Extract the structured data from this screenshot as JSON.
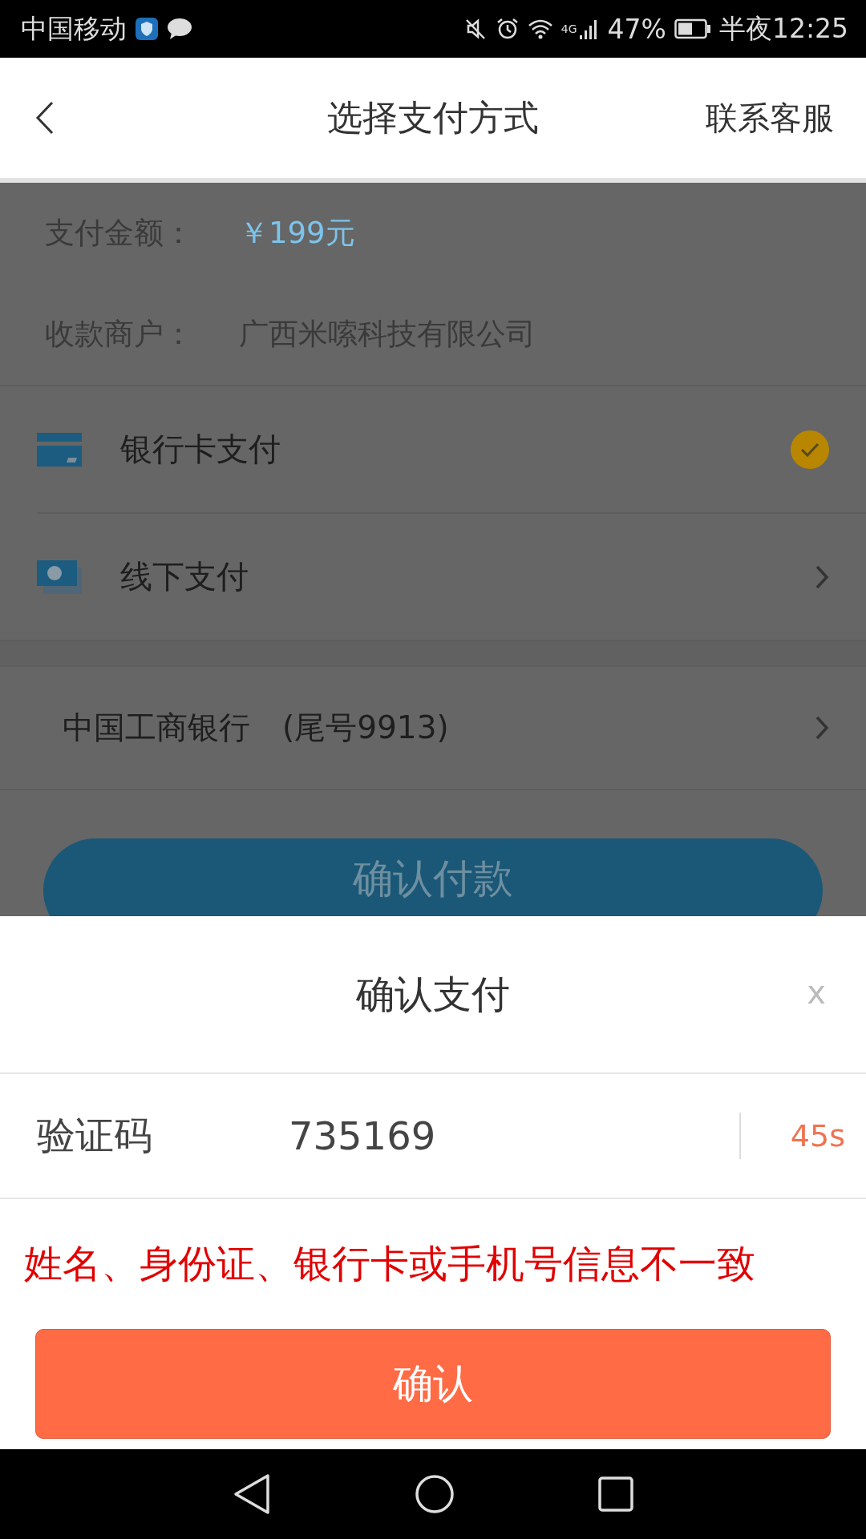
{
  "status_bar": {
    "carrier": "中国移动",
    "network": "4G",
    "battery": "47%",
    "time": "半夜12:25"
  },
  "header": {
    "title": "选择支付方式",
    "action": "联系客服"
  },
  "payment_info": [
    {
      "label": "支付金额：",
      "value": "￥199元",
      "kind": "amount"
    },
    {
      "label": "收款商户：",
      "value": "广西米嗦科技有限公司",
      "kind": "merchant"
    }
  ],
  "payment_methods": [
    {
      "label": "银行卡支付",
      "kind": "card",
      "selected": true
    },
    {
      "label": "线下支付",
      "kind": "cash",
      "selected": false
    }
  ],
  "bank": {
    "name": "中国工商银行",
    "tail": "(尾号9913)"
  },
  "pay_button": "确认付款",
  "dialog": {
    "title": "确认支付",
    "close": "x",
    "code_label": "验证码",
    "code_value": "735169",
    "countdown": "45s",
    "error": "姓名、身份证、银行卡或手机号信息不一致",
    "confirm": "确认"
  }
}
